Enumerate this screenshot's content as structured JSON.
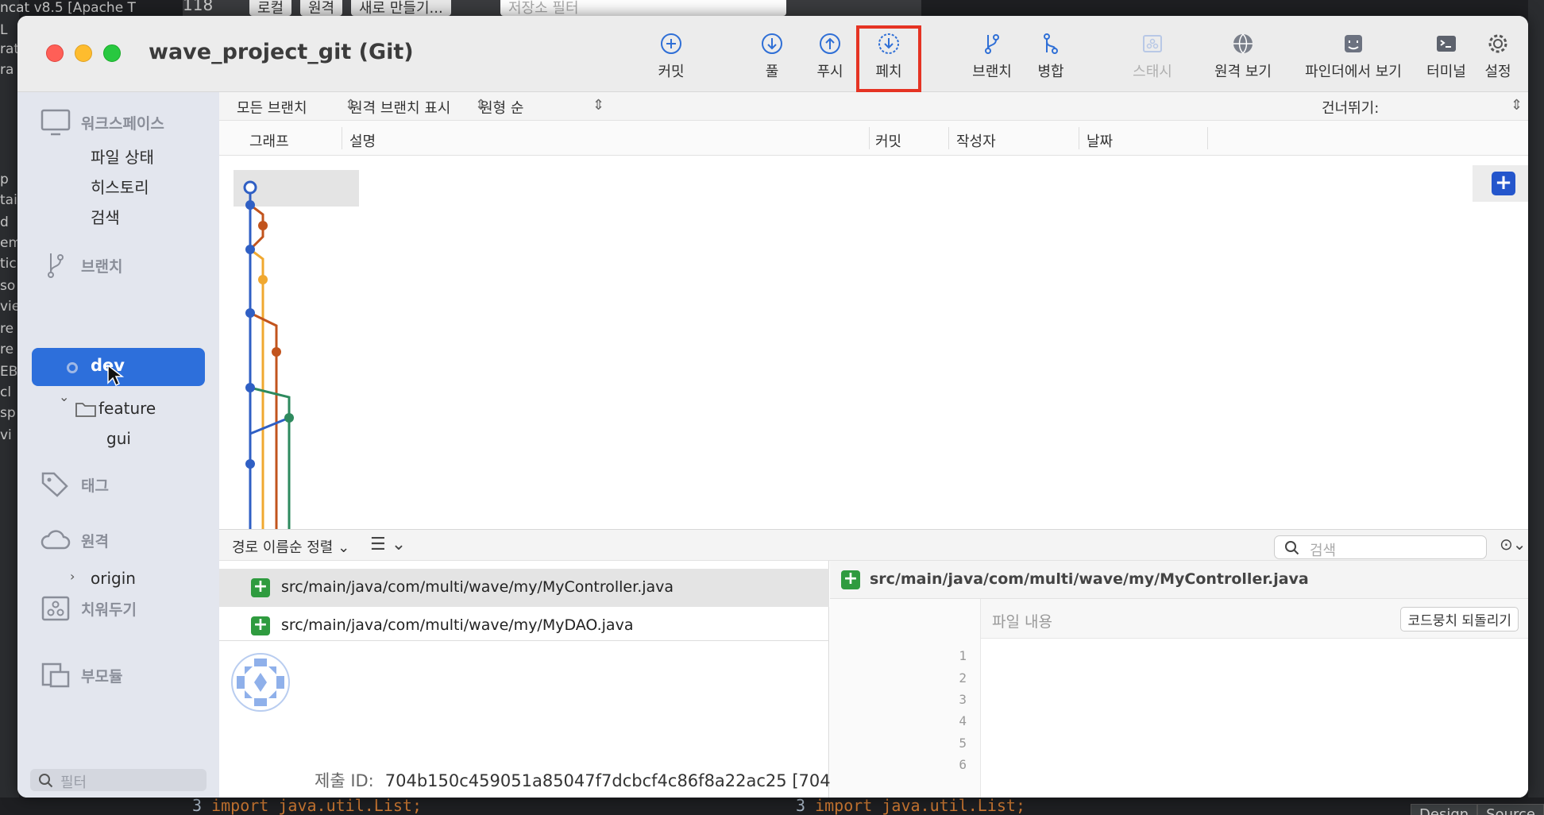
{
  "window": {
    "title": "wave_project_git (Git)"
  },
  "toolbar": {
    "commit": "커밋",
    "pull": "풀",
    "push": "푸시",
    "fetch": "페치",
    "branch": "브랜치",
    "merge": "병합",
    "stash": "스태시",
    "remote_view": "원격 보기",
    "show_in_finder": "파인더에서 보기",
    "terminal": "터미널",
    "settings": "설정"
  },
  "sidebar": {
    "workspace": "워크스페이스",
    "file_status": "파일 상태",
    "history": "히스토리",
    "search": "검색",
    "branches": "브랜치",
    "selected_branch": "dev",
    "folder": "feature",
    "sub_branch": "gui",
    "tags": "태그",
    "remotes": "원격",
    "remote_origin": "origin",
    "stashes": "치워두기",
    "submodules": "부모듈",
    "filter_placeholder": "필터"
  },
  "filterbar": {
    "all_branches": "모든 브랜치",
    "show_remote": "원격 브랜치 표시",
    "order": "원형 순",
    "jump_to": "건너뛰기:"
  },
  "columns": {
    "graph": "그래프",
    "description": "설명",
    "commit": "커밋",
    "author": "작성자",
    "date": "날짜"
  },
  "bottom": {
    "sort": "경로 이름순 정렬",
    "search_placeholder": "검색",
    "files": [
      "src/main/java/com/multi/wave/my/MyController.java",
      "src/main/java/com/multi/wave/my/MyDAO.java"
    ],
    "commit_id_label": "제출 ID:",
    "commit_id_value": "704b150c459051a85047f7dcbcf4c86f8a22ac25 [704"
  },
  "diff": {
    "file": "src/main/java/com/multi/wave/my/MyController.java",
    "hunk_label": "파일 내용",
    "revert_button": "코드뭉치 되돌리기",
    "line_numbers": [
      "1",
      "2",
      "3",
      "4",
      "5",
      "6"
    ]
  },
  "background": {
    "top_tab_1": "로컬",
    "top_tab_2": "원격",
    "top_new": "새로 만들기...",
    "top_filter": "저장소 필터",
    "top_line": "118",
    "left_fragments": [
      "ncat v8.5 [Apache T",
      "L",
      "rat",
      "ra",
      "",
      "p",
      "tai",
      "d",
      "em",
      "tic",
      "so",
      "vie",
      "re",
      "re",
      "EB",
      "cl",
      "sp",
      "vi"
    ],
    "code_left": "import java.util.List;",
    "code_right": "import java.util.List;",
    "line_left": "3",
    "line_right": "3",
    "btn_design": "Design",
    "btn_source": "Source"
  }
}
